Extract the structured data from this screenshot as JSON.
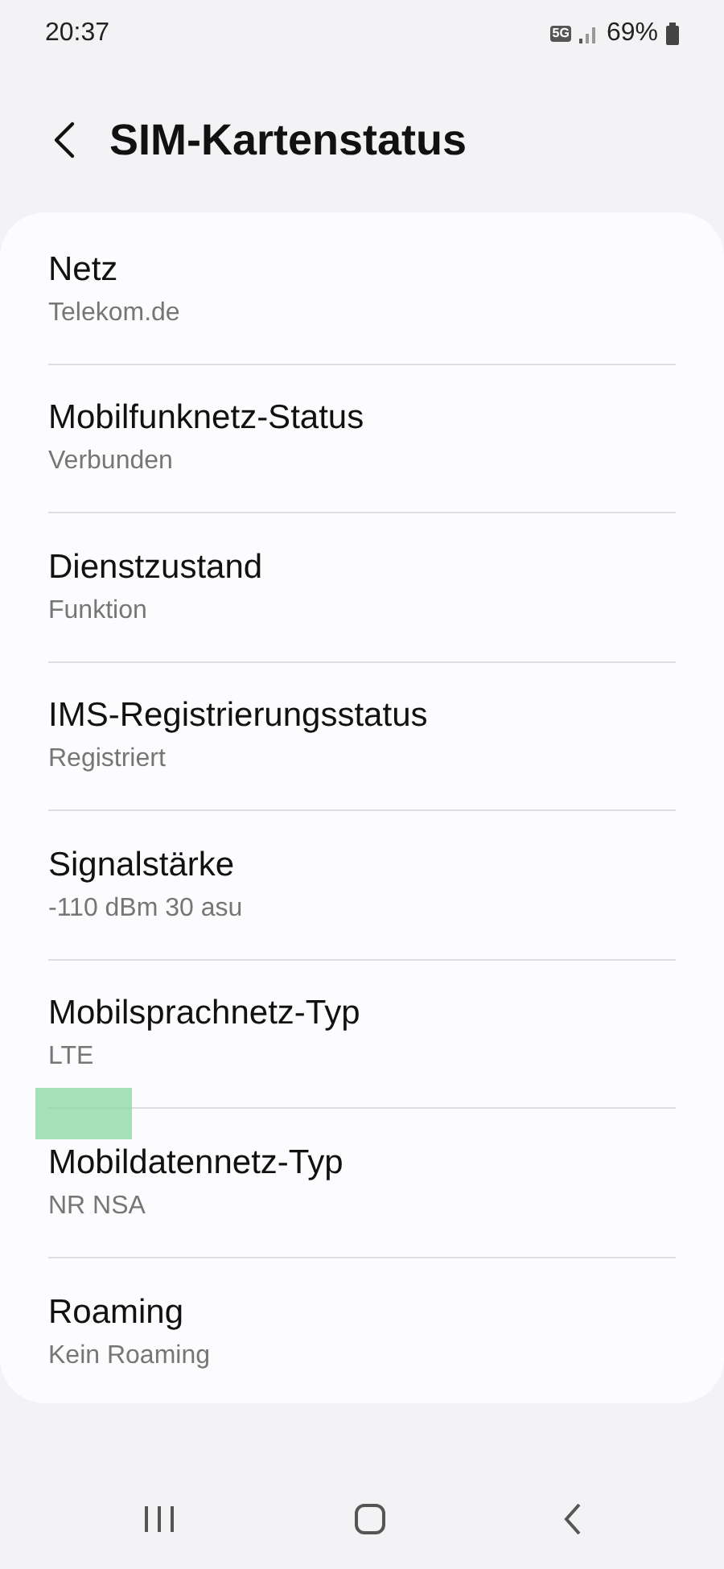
{
  "status_bar": {
    "time": "20:37",
    "network": "5G",
    "battery": "69%"
  },
  "header": {
    "title": "SIM-Kartenstatus"
  },
  "items": [
    {
      "title": "Netz",
      "value": "Telekom.de"
    },
    {
      "title": "Mobilfunknetz-Status",
      "value": "Verbunden"
    },
    {
      "title": "Dienstzustand",
      "value": "Funktion"
    },
    {
      "title": "IMS-Registrierungsstatus",
      "value": "Registriert"
    },
    {
      "title": "Signalstärke",
      "value": "-110 dBm 30 asu"
    },
    {
      "title": "Mobilsprachnetz-Typ",
      "value": "LTE"
    },
    {
      "title": "Mobildatennetz-Typ",
      "value": "NR NSA"
    },
    {
      "title": "Roaming",
      "value": "Kein Roaming"
    }
  ]
}
